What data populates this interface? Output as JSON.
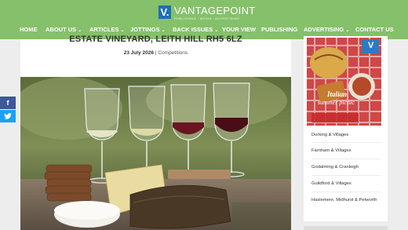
{
  "header": {
    "logo_mark": "V.",
    "logo_name": "VANTAGEPOINT",
    "logo_tagline": "PUBLISHING · MEDIA · ADVERTISING",
    "nav": [
      {
        "label": "HOME",
        "has_dropdown": false
      },
      {
        "label": "ABOUT US",
        "has_dropdown": true
      },
      {
        "label": "ARTICLES",
        "has_dropdown": true
      },
      {
        "label": "JOTTINGS",
        "has_dropdown": true
      },
      {
        "label": "BACK ISSUES",
        "has_dropdown": true
      },
      {
        "label": "YOUR VIEW",
        "has_dropdown": false
      },
      {
        "label": "PUBLISHING",
        "has_dropdown": false
      },
      {
        "label": "ADVERTISING",
        "has_dropdown": true
      },
      {
        "label": "CONTACT US",
        "has_dropdown": false
      }
    ],
    "dropdown_glyph": "⌄"
  },
  "post": {
    "title": "ESTATE VINEYARD, LEITH HILL RH5 6LZ",
    "date": "23 July 2026",
    "separator": "|",
    "category": "Competitions"
  },
  "social": {
    "facebook_glyph": "f",
    "twitter_glyph": "🐦"
  },
  "sidebar": {
    "cover": {
      "badge": "V",
      "headline_line1": "Italian",
      "headline_line2": "summer picnic"
    },
    "items": [
      {
        "label": "Dorking & Villages"
      },
      {
        "label": "Farnham & Villages"
      },
      {
        "label": "Godalming & Cranleigh"
      },
      {
        "label": "Guildford & Villages"
      },
      {
        "label": "Haslemere, Midhurst & Petworth"
      }
    ]
  },
  "colors": {
    "header_green": "#85c06a",
    "logo_blue": "#1f6fb6",
    "facebook": "#3b5998",
    "twitter": "#1da1f2"
  }
}
